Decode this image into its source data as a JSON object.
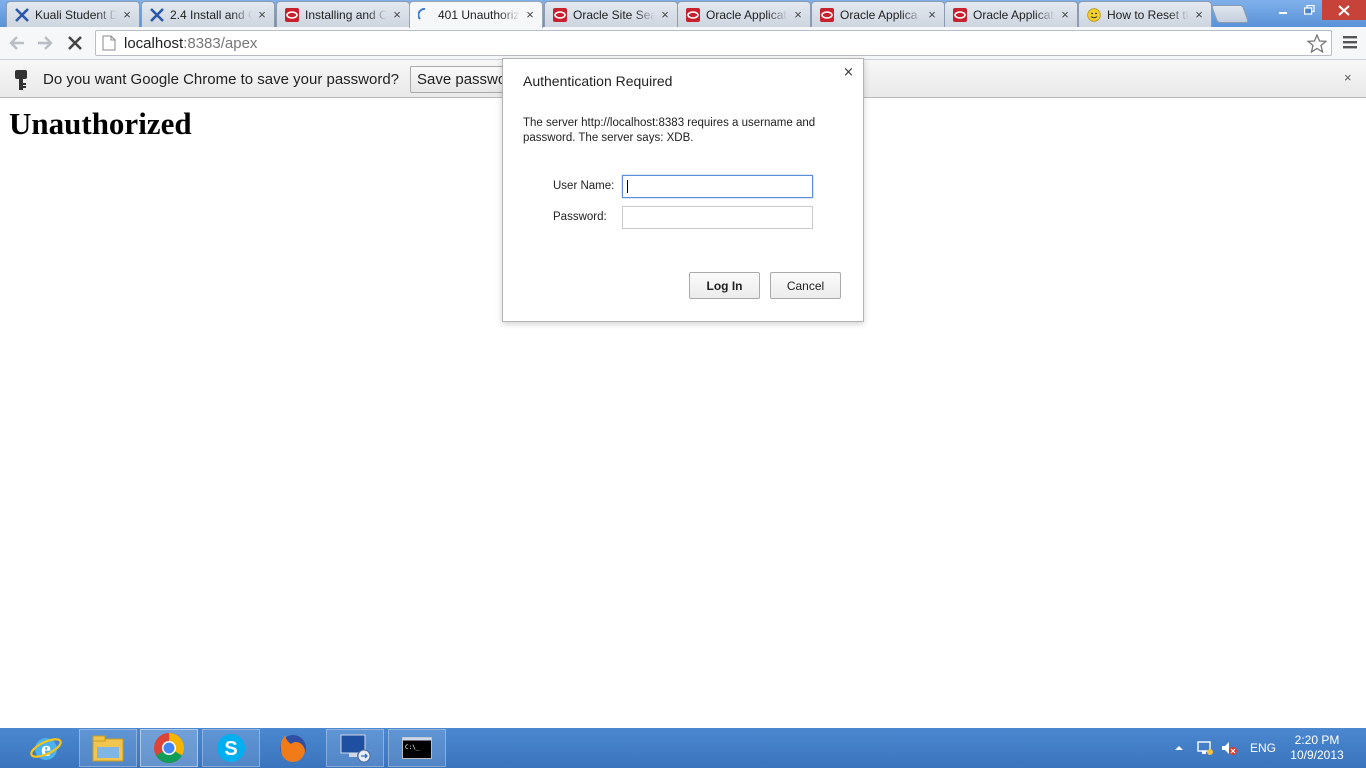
{
  "browser": {
    "tabs": [
      {
        "title": "Kuali Student D",
        "favicon": "kuali-icon",
        "active": false
      },
      {
        "title": "2.4 Install and C",
        "favicon": "kuali-icon",
        "active": false
      },
      {
        "title": "Installing and C",
        "favicon": "oracle-icon",
        "active": false
      },
      {
        "title": "401 Unauthoriz",
        "favicon": "loading-spinner-icon",
        "active": true
      },
      {
        "title": "Oracle Site Sea",
        "favicon": "oracle-icon",
        "active": false
      },
      {
        "title": "Oracle Applicat",
        "favicon": "oracle-icon",
        "active": false
      },
      {
        "title": "Oracle Applica",
        "favicon": "oracle-icon",
        "active": false
      },
      {
        "title": "Oracle Applicat",
        "favicon": "oracle-icon",
        "active": false
      },
      {
        "title": "How to Reset th",
        "favicon": "smiley-icon",
        "active": false
      }
    ],
    "tab_close_glyph": "×",
    "url_host": "localhost",
    "url_rest": ":8383/apex"
  },
  "infobar": {
    "message": "Do you want Google Chrome to save your password?",
    "save_label": "Save password",
    "close_glyph": "×"
  },
  "page": {
    "heading": "Unauthorized"
  },
  "auth_dialog": {
    "title": "Authentication Required",
    "close_glyph": "×",
    "description": "The server http://localhost:8383 requires a username and password. The server says: XDB.",
    "username_label": "User Name:",
    "password_label": "Password:",
    "username_value": "",
    "password_value": "",
    "login_label": "Log In",
    "cancel_label": "Cancel"
  },
  "taskbar": {
    "apps": [
      "internet-explorer-icon",
      "file-explorer-icon",
      "chrome-icon",
      "skype-icon",
      "firefox-icon",
      "remote-desktop-icon",
      "command-prompt-icon"
    ],
    "language": "ENG",
    "time": "2:20 PM",
    "date": "10/9/2013"
  },
  "colors": {
    "tab_strip": "#5a92d8",
    "taskbar": "#3f7cc6",
    "window_close": "#c7433a",
    "focus_border": "#5b8dd8"
  }
}
